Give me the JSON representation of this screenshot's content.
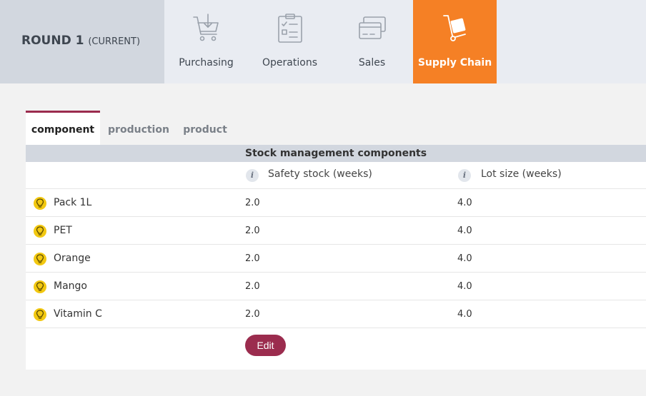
{
  "round": {
    "title": "ROUND 1",
    "status": "(CURRENT)"
  },
  "nav": [
    {
      "label": "Purchasing",
      "icon": "cart-icon",
      "active": false
    },
    {
      "label": "Operations",
      "icon": "checklist-icon",
      "active": false
    },
    {
      "label": "Sales",
      "icon": "credit-card-icon",
      "active": false
    },
    {
      "label": "Supply Chain",
      "icon": "hand-truck-icon",
      "active": true
    }
  ],
  "subtabs": [
    {
      "label": "component",
      "active": true
    },
    {
      "label": "production",
      "active": false
    },
    {
      "label": "product",
      "active": false
    }
  ],
  "table": {
    "title": "Stock management components",
    "columns": [
      {
        "info": "i",
        "label": "Safety stock (weeks)"
      },
      {
        "info": "i",
        "label": "Lot size (weeks)"
      }
    ],
    "rows": [
      {
        "name": "Pack 1L",
        "safety_stock": "2.0",
        "lot_size": "4.0"
      },
      {
        "name": "PET",
        "safety_stock": "2.0",
        "lot_size": "4.0"
      },
      {
        "name": "Orange",
        "safety_stock": "2.0",
        "lot_size": "4.0"
      },
      {
        "name": "Mango",
        "safety_stock": "2.0",
        "lot_size": "4.0"
      },
      {
        "name": "Vitamin C",
        "safety_stock": "2.0",
        "lot_size": "4.0"
      }
    ]
  },
  "edit_label": "Edit",
  "colors": {
    "accent": "#f58025",
    "primary": "#9b2c4e",
    "bulb": "#f2c811",
    "header": "#d2d7df"
  }
}
